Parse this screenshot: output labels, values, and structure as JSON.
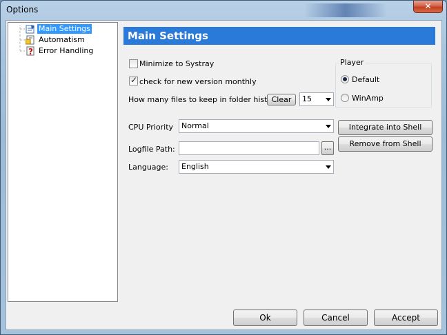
{
  "window": {
    "title": "Options",
    "close_glyph": "✕"
  },
  "tree": {
    "items": [
      {
        "label": "Main Settings",
        "icon": "main-settings-icon",
        "selected": true
      },
      {
        "label": "Automatism",
        "icon": "automatism-icon",
        "selected": false
      },
      {
        "label": "Error Handling",
        "icon": "error-handling-icon",
        "selected": false
      }
    ]
  },
  "main": {
    "header": "Main Settings",
    "minimize_to_systray": {
      "label": "Minimize to Systray",
      "checked": false
    },
    "check_version": {
      "label": "check for new version monthly",
      "checked": true
    },
    "history": {
      "label": "How many files to keep in folder history:",
      "clear_label": "Clear",
      "value": "15"
    },
    "player": {
      "legend": "Player",
      "options": [
        "Default",
        "WinAmp"
      ],
      "selected": "Default"
    },
    "cpu_priority": {
      "label": "CPU Priority",
      "value": "Normal"
    },
    "logfile": {
      "label": "Logfile Path:",
      "value": "",
      "browse_label": "..."
    },
    "language": {
      "label": "Language:",
      "value": "English"
    },
    "integrate_label": "Integrate into Shell",
    "remove_label": "Remove from Shell"
  },
  "footer": {
    "ok_label": "Ok",
    "cancel_label": "Cancel",
    "accept_label": "Accept"
  },
  "colors": {
    "header_bg": "#2a7ad9",
    "selection": "#3399ff"
  }
}
